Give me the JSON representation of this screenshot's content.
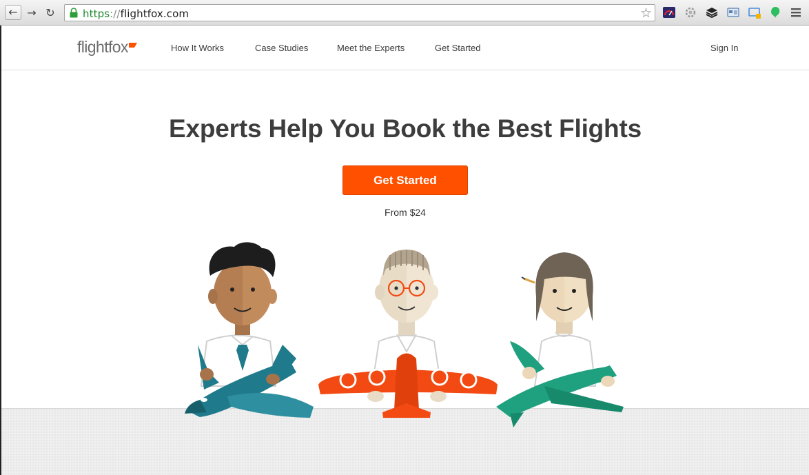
{
  "browser": {
    "url_scheme": "https",
    "url_separator": "://",
    "url_host": "flightfox.com",
    "back_glyph": "←",
    "forward_glyph": "→",
    "reload_glyph": "↻",
    "bookmark_glyph": "☆"
  },
  "header": {
    "logo_text": "flightfox",
    "nav": [
      {
        "label": "How It Works"
      },
      {
        "label": "Case Studies"
      },
      {
        "label": "Meet the Experts"
      },
      {
        "label": "Get Started"
      }
    ],
    "sign_in": "Sign In"
  },
  "hero": {
    "title": "Experts Help You Book the Best Flights",
    "cta_label": "Get Started",
    "price_note": "From $24"
  },
  "colors": {
    "accent": "#ff5000",
    "teal_plane": "#1f7b8c",
    "green_plane": "#1fa07e",
    "orange_plane": "#f24a12"
  },
  "icons": [
    "lock-icon",
    "star-icon",
    "speedometer-icon",
    "gear-icon",
    "layers-icon",
    "screenshot-icon",
    "cast-icon",
    "evernote-icon",
    "menu-icon"
  ]
}
